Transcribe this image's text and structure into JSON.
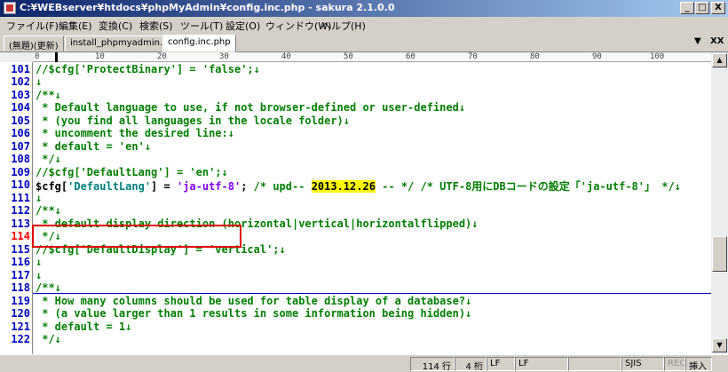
{
  "window": {
    "title": "C:¥WEBserver¥htdocs¥phpMyAdmin¥config.inc.php - sakura 2.1.0.0",
    "buttons": {
      "minimize": "_",
      "maximize": "□",
      "close": "X"
    }
  },
  "menu": [
    "ファイル(F)",
    "編集(E)",
    "変換(C)",
    "検索(S)",
    "ツール(T)",
    "設定(O)",
    "ウィンドウ(W)",
    "ヘルプ(H)"
  ],
  "tabs": [
    {
      "label": "(無題)(更新)",
      "active": false
    },
    {
      "label": "install_phpmyadmin.php",
      "active": false
    },
    {
      "label": "config.inc.php",
      "active": true
    }
  ],
  "tab_controls": {
    "scroll": "▼",
    "close": "XX"
  },
  "ruler_ticks": [
    "0",
    "10",
    "20",
    "30",
    "40",
    "50",
    "60",
    "70",
    "80",
    "90",
    "100"
  ],
  "lines": [
    {
      "num": "101",
      "text": "//$cfg['ProtectBinary'] = 'false';↓"
    },
    {
      "num": "102",
      "text": "↓"
    },
    {
      "num": "103",
      "text": "/**↓"
    },
    {
      "num": "104",
      "text": " * Default language to use, if not browser-defined or user-defined↓"
    },
    {
      "num": "105",
      "text": " * (you find all languages in the locale folder)↓"
    },
    {
      "num": "106",
      "text": " * uncomment the desired line:↓"
    },
    {
      "num": "107",
      "text": " * default = 'en'↓"
    },
    {
      "num": "108",
      "text": " */↓"
    },
    {
      "num": "109",
      "text": "//$cfg['DefaultLang'] = 'en';↓"
    },
    {
      "num": "110",
      "p1": "$cfg[",
      "p2": "'DefaultLang'",
      "p3": "] = ",
      "p4": "'ja-utf-8'",
      "p5": ";",
      "p6": " /* upd-- ",
      "p7": "2013.12.26",
      "p8": " -- */ /* UTF-8用にDBコードの設定「'ja-utf-8'」 */↓"
    },
    {
      "num": "111",
      "text": "↓"
    },
    {
      "num": "112",
      "text": "/**↓"
    },
    {
      "num": "113",
      "text": " * default display direction (horizontal|vertical|horizontalflipped)↓"
    },
    {
      "num": "114",
      "text": " */↓"
    },
    {
      "num": "115",
      "text": "//$cfg['DefaultDisplay'] = 'vertical';↓"
    },
    {
      "num": "116",
      "text": "↓"
    },
    {
      "num": "117",
      "text": "↓"
    },
    {
      "num": "118",
      "text": "/**↓"
    },
    {
      "num": "119",
      "text": " * How many columns should be used for table display of a database?↓"
    },
    {
      "num": "120",
      "text": " * (a value larger than 1 results in some information being hidden)↓"
    },
    {
      "num": "121",
      "text": " * default = 1↓"
    },
    {
      "num": "122",
      "text": " */↓"
    }
  ],
  "status": {
    "row": "114 行",
    "col": "4 桁",
    "eol1": "LF",
    "eol2": "LF",
    "encoding": "SJIS",
    "rec": "REC",
    "mode": "挿入"
  }
}
